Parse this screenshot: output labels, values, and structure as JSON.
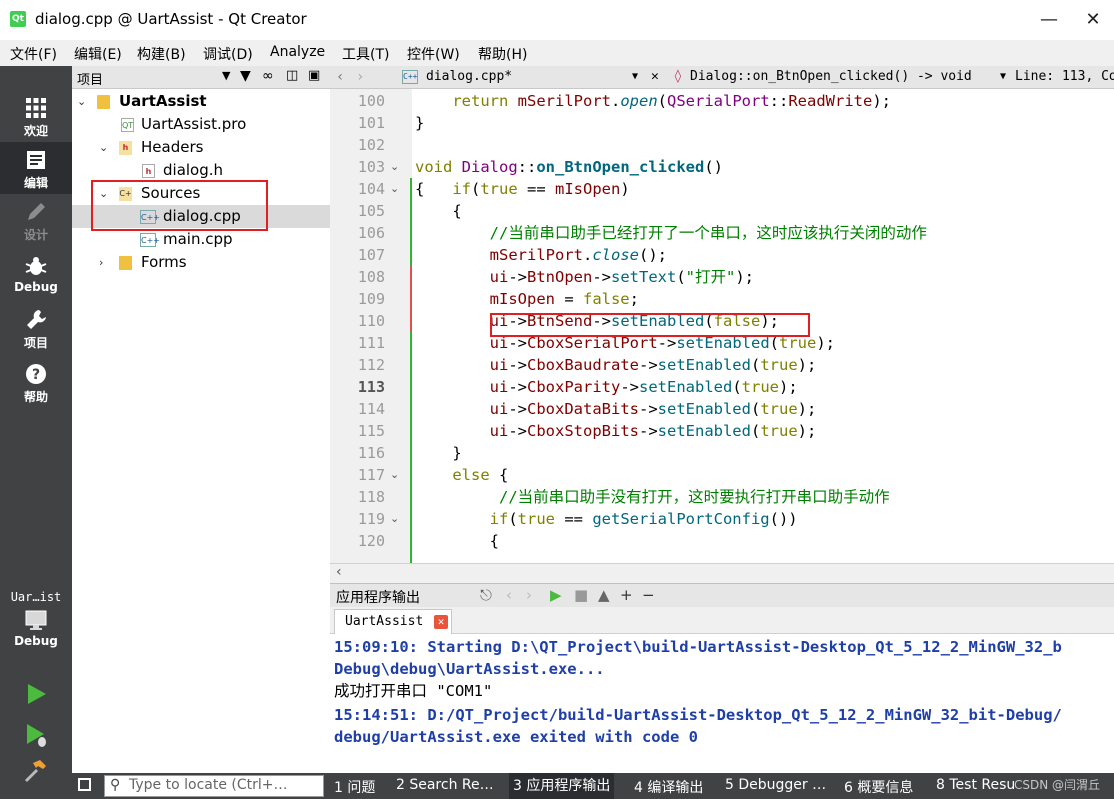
{
  "window": {
    "title": "dialog.cpp @ UartAssist - Qt Creator",
    "app_badge": "Qt"
  },
  "menu": [
    "文件(F)",
    "编辑(E)",
    "构建(B)",
    "调试(D)",
    "Analyze",
    "工具(T)",
    "控件(W)",
    "帮助(H)"
  ],
  "modes": {
    "welcome": "欢迎",
    "edit": "编辑",
    "design": "设计",
    "debug": "Debug",
    "projects": "项目",
    "help": "帮助",
    "kit": "Uar…ist",
    "kit_mode": "Debug"
  },
  "project_panel": {
    "title": "项目",
    "tree": {
      "root": "UartAssist",
      "pro": "UartAssist.pro",
      "headers": "Headers",
      "header_file": "dialog.h",
      "sources": "Sources",
      "source_dialog": "dialog.cpp",
      "source_main": "main.cpp",
      "forms": "Forms"
    }
  },
  "editor_toolbar": {
    "file": "dialog.cpp*",
    "symbol": "Dialog::on_BtnOpen_clicked() -> void",
    "position": "Line: 113, Co"
  },
  "editor": {
    "line_numbers": [
      "100",
      "101",
      "102",
      "103",
      "104",
      "105",
      "106",
      "107",
      "108",
      "109",
      "110",
      "111",
      "112",
      "113",
      "114",
      "115",
      "116",
      "117",
      "118",
      "119",
      "120"
    ],
    "current_line": "113"
  },
  "output": {
    "pane_title": "应用程序输出",
    "tab_label": "UartAssist",
    "lines": [
      "15:09:10: Starting D:\\QT_Project\\build-UartAssist-Desktop_Qt_5_12_2_MinGW_32_b",
      "Debug\\debug\\UartAssist.exe...",
      "成功打开串口 \"COM1\"",
      "15:14:51: D:/QT_Project/build-UartAssist-Desktop_Qt_5_12_2_MinGW_32_bit-Debug/",
      "debug/UartAssist.exe exited with code 0"
    ]
  },
  "statusbar": {
    "locate_placeholder": "Type to locate (Ctrl+…",
    "tabs": [
      "1 问题",
      "2 Search Re…",
      "3 应用程序输出",
      "4 编译输出",
      "5 Debugger …",
      "6 概要信息",
      "8 Test Resu"
    ]
  },
  "watermark": "CSDN @闫渭丘",
  "colors": {
    "modebar": "#404244",
    "highlight_box": "#e02020",
    "output_blue": "#1f3fa8"
  }
}
